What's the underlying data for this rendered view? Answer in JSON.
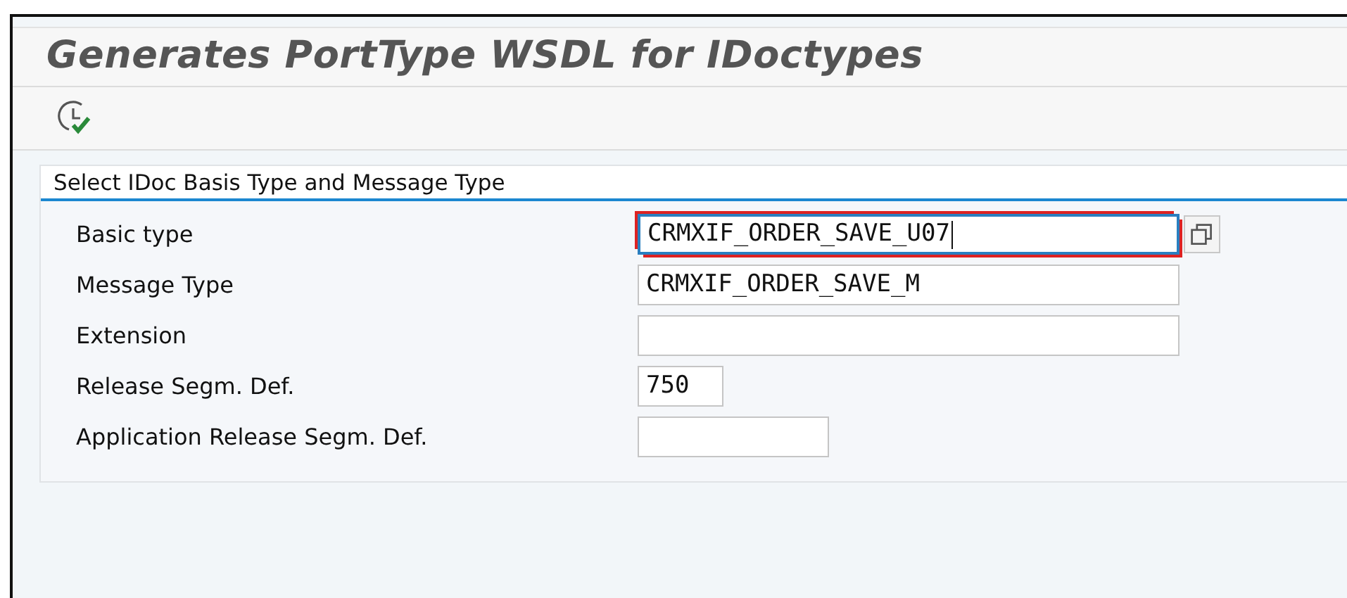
{
  "window": {
    "title": "Generates PortType WSDL for IDoctypes"
  },
  "toolbar": {
    "buttons": [
      {
        "kind": "execute"
      }
    ]
  },
  "section": {
    "title": "Select IDoc Basis Type and Message Type",
    "fields": [
      {
        "label": "Basic type",
        "value": "CRMXIF_ORDER_SAVE_U07",
        "focused": true,
        "value_help": true
      },
      {
        "label": "Message Type",
        "value": "CRMXIF_ORDER_SAVE_M",
        "focused": false,
        "value_help": false
      },
      {
        "label": "Extension",
        "focused": false,
        "value_help": false
      },
      {
        "label": "Release Segm. Def.",
        "value": "750",
        "focused": false,
        "value_help": false
      },
      {
        "label": "Application Release Segm. Def.",
        "focused": false,
        "value_help": false
      }
    ]
  }
}
